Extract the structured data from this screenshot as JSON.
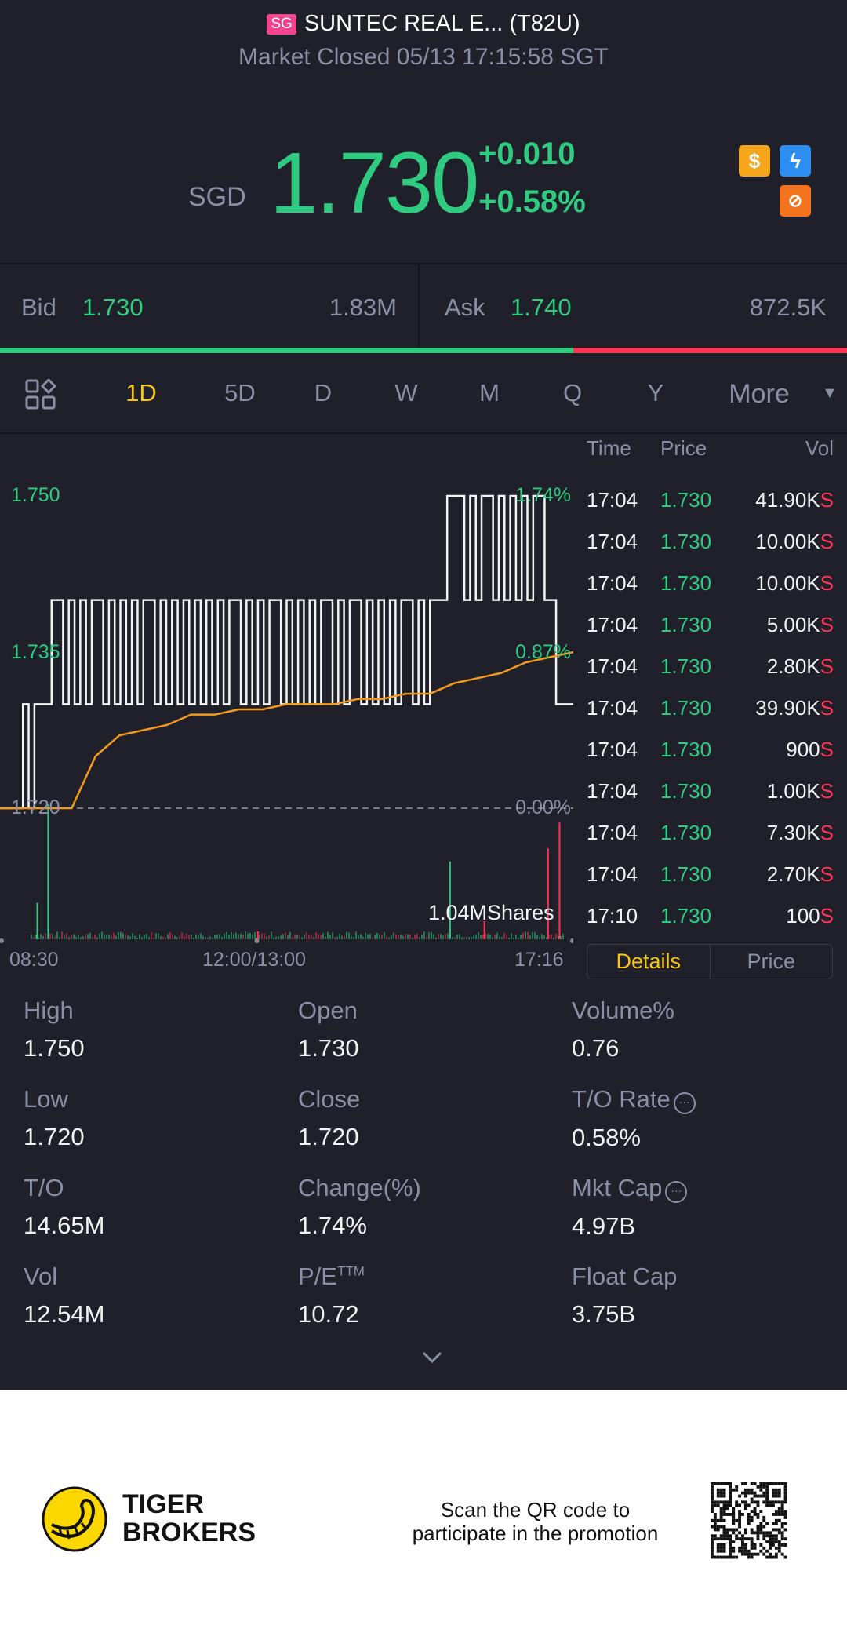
{
  "header": {
    "market_badge": "SG",
    "title": "SUNTEC REAL E... (T82U)",
    "status": "Market Closed 05/13 17:15:58 SGT"
  },
  "quote": {
    "currency": "SGD",
    "price": "1.730",
    "change": "+0.010",
    "change_pct": "+0.58%",
    "icons": [
      "dollar-icon",
      "lightning-icon",
      "short-sell-icon"
    ]
  },
  "bidask": {
    "bid_label": "Bid",
    "bid_price": "1.730",
    "bid_size": "1.83M",
    "ask_label": "Ask",
    "ask_price": "1.740",
    "ask_size": "872.5K",
    "bid_ratio": 0.677
  },
  "tabs": {
    "items": [
      "1D",
      "5D",
      "D",
      "W",
      "M",
      "Q",
      "Y",
      "More"
    ],
    "active": "1D"
  },
  "chart_data": {
    "type": "line",
    "y_left_ticks": [
      "1.750",
      "1.735",
      "1.720"
    ],
    "y_right_ticks": [
      "1.74%",
      "0.87%",
      "0.00%"
    ],
    "x_ticks": [
      "08:30",
      "12:00/13:00",
      "17:16"
    ],
    "ylim": [
      1.72,
      1.75
    ],
    "prev_close": 1.72,
    "volume_label": "1.04MShares",
    "price_samples": [
      1.72,
      1.72,
      1.72,
      1.72,
      1.73,
      1.72,
      1.73,
      1.73,
      1.73,
      1.74,
      1.74,
      1.73,
      1.74,
      1.73,
      1.74,
      1.73,
      1.74,
      1.74,
      1.73,
      1.74,
      1.73,
      1.74,
      1.73,
      1.74,
      1.73,
      1.74,
      1.74,
      1.73,
      1.74,
      1.73,
      1.74,
      1.73,
      1.74,
      1.73,
      1.74,
      1.73,
      1.74,
      1.73,
      1.74,
      1.73,
      1.74,
      1.74,
      1.73,
      1.74,
      1.73,
      1.74,
      1.73,
      1.74,
      1.74,
      1.73,
      1.74,
      1.73,
      1.74,
      1.73,
      1.74,
      1.73,
      1.74,
      1.74,
      1.73,
      1.74,
      1.73,
      1.74,
      1.74,
      1.73,
      1.74,
      1.73,
      1.74,
      1.73,
      1.74,
      1.73,
      1.74,
      1.74,
      1.73,
      1.74,
      1.73,
      1.74,
      1.74,
      1.74,
      1.75,
      1.75,
      1.75,
      1.74,
      1.75,
      1.74,
      1.75,
      1.75,
      1.74,
      1.75,
      1.74,
      1.75,
      1.74,
      1.75,
      1.74,
      1.75,
      1.75,
      1.74,
      1.74,
      1.73,
      1.73,
      1.73
    ],
    "avg_samples": [
      1.72,
      1.72,
      1.72,
      1.72,
      1.725,
      1.727,
      1.7275,
      1.728,
      1.729,
      1.729,
      1.7295,
      1.7295,
      1.73,
      1.73,
      1.73,
      1.7305,
      1.7305,
      1.731,
      1.731,
      1.732,
      1.7325,
      1.733,
      1.734,
      1.7345,
      1.735
    ],
    "volume_spikes": [
      {
        "i": 6.5,
        "v": 0.28,
        "side": "buy"
      },
      {
        "i": 8.4,
        "v": 1.04,
        "side": "buy"
      },
      {
        "i": 45,
        "v": 0.06,
        "side": "sell"
      },
      {
        "i": 78.5,
        "v": 0.6,
        "side": "buy"
      },
      {
        "i": 84.5,
        "v": 0.14,
        "side": "sell"
      },
      {
        "i": 95.6,
        "v": 0.7,
        "side": "sell"
      },
      {
        "i": 97.6,
        "v": 0.9,
        "side": "sell"
      }
    ]
  },
  "trades": {
    "headers": [
      "Time",
      "Price",
      "Vol"
    ],
    "rows": [
      {
        "time": "17:04",
        "price": "1.730",
        "vol": "41.90K",
        "side": "S"
      },
      {
        "time": "17:04",
        "price": "1.730",
        "vol": "10.00K",
        "side": "S"
      },
      {
        "time": "17:04",
        "price": "1.730",
        "vol": "10.00K",
        "side": "S"
      },
      {
        "time": "17:04",
        "price": "1.730",
        "vol": "5.00K",
        "side": "S"
      },
      {
        "time": "17:04",
        "price": "1.730",
        "vol": "2.80K",
        "side": "S"
      },
      {
        "time": "17:04",
        "price": "1.730",
        "vol": "39.90K",
        "side": "S"
      },
      {
        "time": "17:04",
        "price": "1.730",
        "vol": "900",
        "side": "S"
      },
      {
        "time": "17:04",
        "price": "1.730",
        "vol": "1.00K",
        "side": "S"
      },
      {
        "time": "17:04",
        "price": "1.730",
        "vol": "7.30K",
        "side": "S"
      },
      {
        "time": "17:04",
        "price": "1.730",
        "vol": "2.70K",
        "side": "S"
      },
      {
        "time": "17:10",
        "price": "1.730",
        "vol": "100",
        "side": "S"
      }
    ],
    "toggle": [
      "Details",
      "Price"
    ],
    "active": "Details"
  },
  "stats": [
    {
      "label": "High",
      "value": "1.750"
    },
    {
      "label": "Open",
      "value": "1.730"
    },
    {
      "label": "Volume%",
      "value": "0.76"
    },
    {
      "label": "Low",
      "value": "1.720"
    },
    {
      "label": "Close",
      "value": "1.720"
    },
    {
      "label": "T/O Rate",
      "value": "0.58%",
      "info": true
    },
    {
      "label": "T/O",
      "value": "14.65M"
    },
    {
      "label": "Change(%)",
      "value": "1.74%"
    },
    {
      "label": "Mkt Cap",
      "value": "4.97B",
      "info": true
    },
    {
      "label": "Vol",
      "value": "12.54M"
    },
    {
      "label": "P/E",
      "sup": "TTM",
      "value": "10.72"
    },
    {
      "label": "Float Cap",
      "value": "3.75B"
    }
  ],
  "footer": {
    "brand_line1": "TIGER",
    "brand_line2": "BROKERS",
    "promo_line1": "Scan the QR code to",
    "promo_line2": "participate in the promotion"
  },
  "colors": {
    "up": "#2fcb80",
    "down": "#fd3556",
    "accent": "#f5c518",
    "background": "#1f2029"
  }
}
